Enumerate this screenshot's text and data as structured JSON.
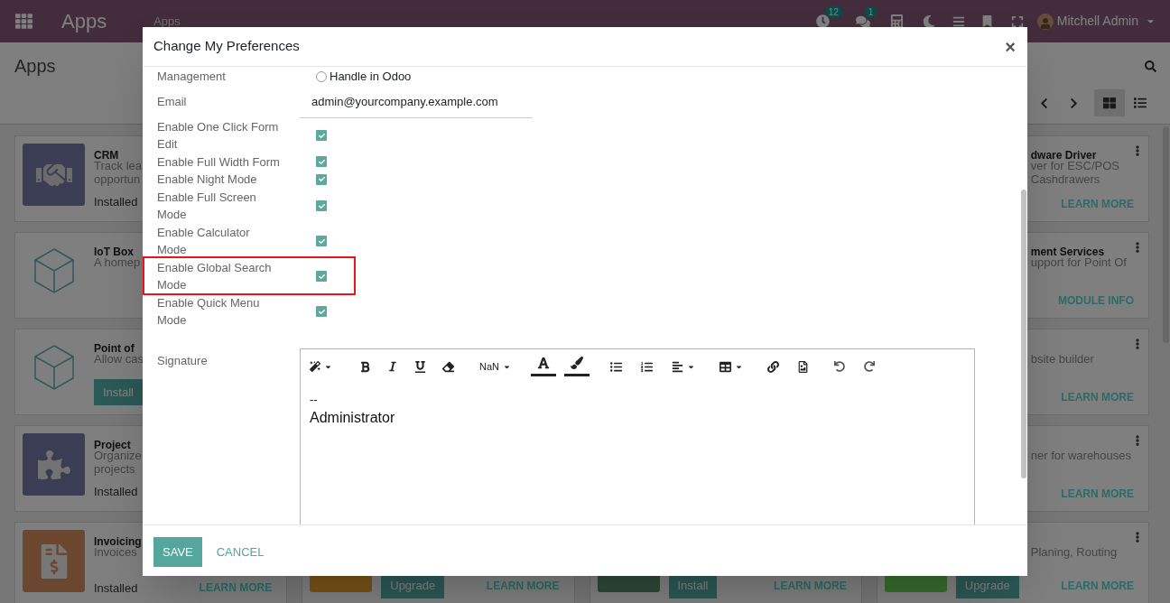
{
  "navbar": {
    "brand": "Apps",
    "menu": [
      "Apps"
    ],
    "activity_badge": "12",
    "message_badge": "1",
    "user": "Mitchell Admin"
  },
  "control_panel": {
    "title": "Apps",
    "views": [
      {
        "kind": "kanban",
        "selected": true
      },
      {
        "kind": "list",
        "selected": false
      }
    ]
  },
  "apps_left": [
    {
      "title": "CRM",
      "lines": [
        "Track lea",
        "opportun"
      ],
      "status": "Installed"
    },
    {
      "title": "IoT Box",
      "lines": [
        "A homep"
      ]
    },
    {
      "title": "Point of",
      "lines": [
        "Allow cas"
      ],
      "button": "Install"
    },
    {
      "title": "Project",
      "lines": [
        "Organize",
        "projects"
      ],
      "status": "Installed"
    },
    {
      "title": "Invoicing",
      "lines": [
        "Invoices"
      ],
      "status": "Installed",
      "link": "LEARN MORE"
    }
  ],
  "apps_bottom": [
    {
      "button": "Upgrade",
      "link": "LEARN MORE"
    },
    {
      "button": "Install",
      "link": "LEARN MORE"
    }
  ],
  "apps_right": [
    {
      "title": "dware Driver",
      "lines": [
        "ver for ESC/POS",
        "Cashdrawers"
      ],
      "link": "LEARN MORE"
    },
    {
      "title": "ment Services",
      "lines": [
        "upport for Point Of"
      ],
      "link": "MODULE INFO"
    },
    {
      "lines": [
        "bsite builder"
      ],
      "link": "LEARN MORE"
    },
    {
      "lines": [
        "ner for warehouses"
      ],
      "link": "LEARN MORE"
    },
    {
      "lines": [
        "Planing, Routing"
      ],
      "button": "Upgrade",
      "link": "LEARN MORE"
    }
  ],
  "dialog": {
    "title": "Change My Preferences",
    "close": "×",
    "fields": [
      {
        "kind": "radio",
        "label": "Management",
        "option": "Handle in Odoo",
        "checked": false
      },
      {
        "kind": "text",
        "label": "Email",
        "value": "admin@yourcompany.example.com"
      },
      {
        "kind": "checkbox",
        "label": "Enable One Click Form Edit",
        "checked": true,
        "highlighted": false
      },
      {
        "kind": "checkbox",
        "label": "Enable Full Width Form",
        "checked": true,
        "highlighted": false
      },
      {
        "kind": "checkbox",
        "label": "Enable Night Mode",
        "checked": true,
        "highlighted": false
      },
      {
        "kind": "checkbox",
        "label": "Enable Full Screen Mode",
        "checked": true,
        "highlighted": false
      },
      {
        "kind": "checkbox",
        "label": "Enable Calculator Mode",
        "checked": true,
        "highlighted": false
      },
      {
        "kind": "checkbox",
        "label": "Enable Global Search Mode",
        "checked": true,
        "highlighted": true
      },
      {
        "kind": "checkbox",
        "label": "Enable Quick Menu Mode",
        "checked": true,
        "highlighted": false
      }
    ],
    "signature": {
      "label": "Signature",
      "size_picker": "NaN",
      "lines": [
        "--",
        "Administrator"
      ]
    },
    "buttons": [
      {
        "kind": "primary",
        "label": "SAVE"
      },
      {
        "kind": "link",
        "label": "CANCEL"
      }
    ]
  }
}
